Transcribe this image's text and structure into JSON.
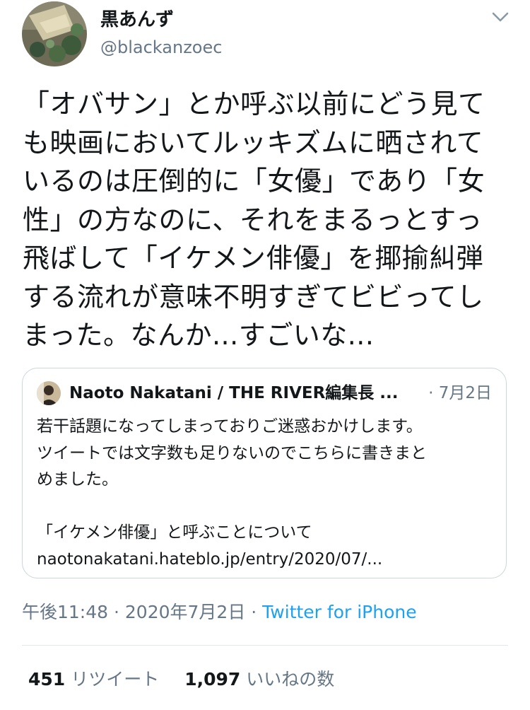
{
  "author": {
    "display_name": "黒あんず",
    "handle": "@blackanzoec"
  },
  "tweet": {
    "lines": [
      "「オバサン」とか呼ぶ以前にどう見て",
      "も映画においてルッキズムに晒されて",
      "いるのは圧倒的に「女優」であり「女",
      "性」の方なのに、それをまるっとすっ",
      "飛ばして「イケメン俳優」を揶揄糾弾",
      "する流れが意味不明すぎてビビってし",
      "まった。なんか...すごいな..."
    ]
  },
  "quoted_tweet": {
    "author_name": "Naoto Nakatani / THE RIVER編集長 ...",
    "meta": "· 7月2日",
    "lines": [
      "若干話題になってしまっておりご迷惑おかけします。",
      "ツイートでは文字数も足りないのでこちらに書きまと",
      "めました。",
      "",
      "「イケメン俳優」と呼ぶことについて",
      "naotonakatani.hateblo.jp/entry/2020/07/..."
    ]
  },
  "meta": {
    "timestamp": "午後11:48 · 2020年7月2日 · ",
    "source": "Twitter for iPhone"
  },
  "stats": {
    "retweets_count": "451",
    "retweets_label": "リツイート",
    "likes_count": "1,097",
    "likes_label": "いいねの数"
  },
  "colors": {
    "text": "#14171a",
    "secondary": "#657786",
    "link": "#1da1f2",
    "border": "#ccd6dd"
  },
  "icons": {
    "caret": "chevron-down-icon"
  }
}
